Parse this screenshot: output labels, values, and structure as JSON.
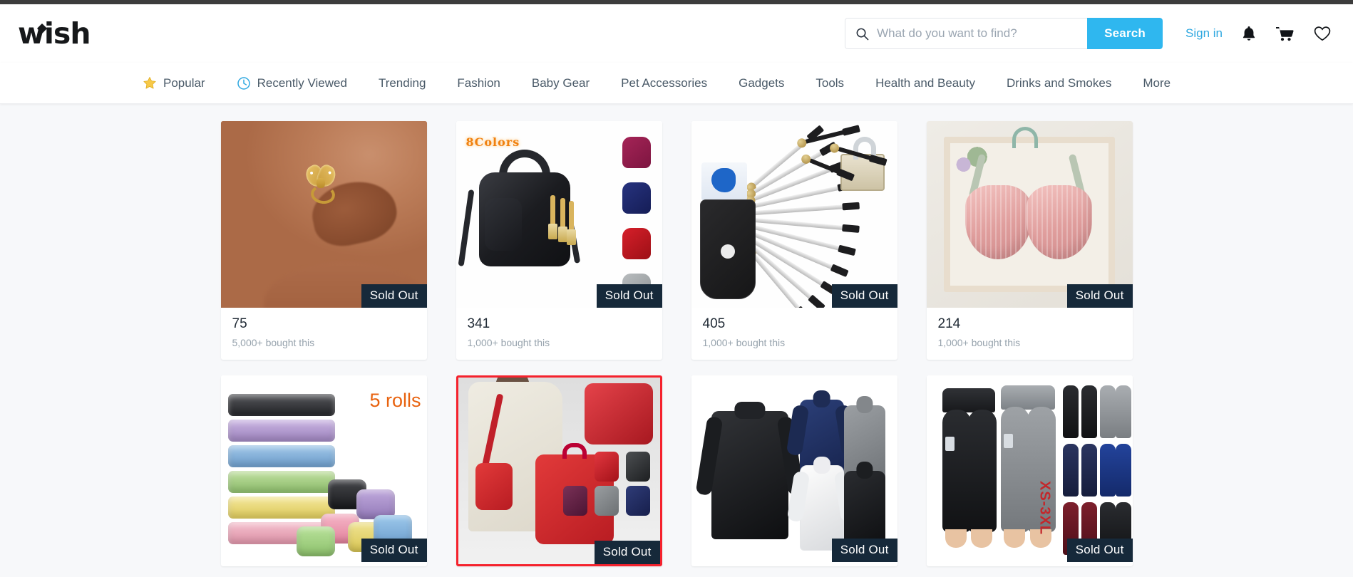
{
  "brand": {
    "name": "wish"
  },
  "search": {
    "placeholder": "What do you want to find?",
    "value": "",
    "button_label": "Search",
    "icon": "search-icon",
    "button_color": "#2fb7ef"
  },
  "account": {
    "sign_in_label": "Sign in",
    "sign_in_color": "#2fa8e0",
    "icons": [
      {
        "name": "notifications-bell-icon"
      },
      {
        "name": "shopping-cart-icon"
      },
      {
        "name": "wishlist-heart-icon"
      }
    ]
  },
  "nav": {
    "items": [
      {
        "label": "Popular",
        "icon": "star-icon",
        "icon_color": "#f7c948"
      },
      {
        "label": "Recently Viewed",
        "icon": "clock-icon",
        "icon_color": "#2fa8e0"
      },
      {
        "label": "Trending",
        "icon": null
      },
      {
        "label": "Fashion",
        "icon": null
      },
      {
        "label": "Baby Gear",
        "icon": null
      },
      {
        "label": "Pet Accessories",
        "icon": null
      },
      {
        "label": "Gadgets",
        "icon": null
      },
      {
        "label": "Tools",
        "icon": null
      },
      {
        "label": "Health and Beauty",
        "icon": null
      },
      {
        "label": "Drinks and Smokes",
        "icon": null
      },
      {
        "label": "More",
        "icon": null
      }
    ]
  },
  "badges": {
    "sold_out_label": "Sold Out",
    "sold_out_bg": "#16293a"
  },
  "products": [
    {
      "id": "nose-ring",
      "price": "75",
      "bought": "5,000+ bought this",
      "sold_out": "Sold Out",
      "image_alt": "gold butterfly nose ring on nose",
      "overlay_text": ""
    },
    {
      "id": "black-crossbody-bag",
      "price": "341",
      "bought": "1,000+ bought this",
      "sold_out": "Sold Out",
      "image_alt": "black mini crossbody bag with color swatches",
      "overlay_text": "8Colors"
    },
    {
      "id": "lock-pick-set",
      "price": "405",
      "bought": "1,000+ bought this",
      "sold_out": "Sold Out",
      "image_alt": "lock pick tool set with leather pouch and practice padlock",
      "overlay_text": ""
    },
    {
      "id": "pink-bralette",
      "price": "214",
      "bought": "1,000+ bought this",
      "sold_out": "Sold Out",
      "image_alt": "pink ribbed button bralette on wooden frame",
      "overlay_text": ""
    },
    {
      "id": "trash-bag-rolls",
      "price": "",
      "bought": "",
      "sold_out": "Sold Out",
      "image_alt": "stacked colorful trash bag rolls",
      "overlay_text": "5 rolls"
    },
    {
      "id": "red-crossbody-bag",
      "price": "",
      "bought": "",
      "sold_out": "Sold Out",
      "image_alt": "red crossbody phone bag worn by model with color swatches",
      "overlay_text": "",
      "highlighted": true,
      "highlight_color": "#f5222d"
    },
    {
      "id": "mens-turtleneck",
      "price": "",
      "bought": "",
      "sold_out": "Sold Out",
      "image_alt": "black mens turtleneck with blue white grey variants",
      "overlay_text": ""
    },
    {
      "id": "pocket-leggings",
      "price": "",
      "bought": "",
      "sold_out": "Sold Out",
      "image_alt": "black and grey high waist pocket leggings with color variants",
      "overlay_text": "XS-3XL"
    }
  ]
}
